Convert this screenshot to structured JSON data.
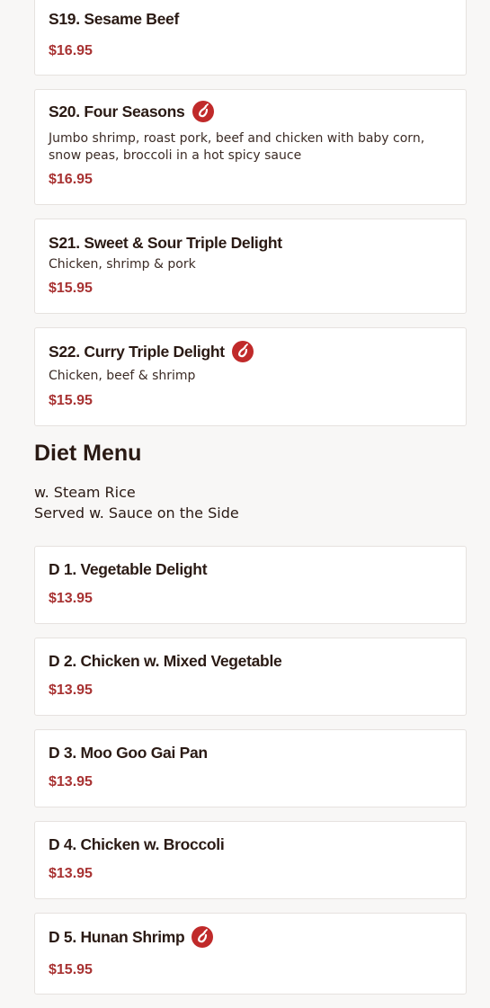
{
  "items_top": [
    {
      "name": "S19. Sesame Beef",
      "price": "$16.95",
      "spicy": false,
      "desc": ""
    },
    {
      "name": "S20. Four Seasons",
      "price": "$16.95",
      "spicy": true,
      "desc": "Jumbo shrimp, roast pork, beef and chicken with baby corn, snow peas, broccoli in a hot spicy sauce"
    },
    {
      "name": "S21. Sweet & Sour Triple Delight",
      "price": "$15.95",
      "spicy": false,
      "desc": "Chicken, shrimp & pork"
    },
    {
      "name": "S22. Curry Triple Delight",
      "price": "$15.95",
      "spicy": true,
      "desc": "Chicken, beef & shrimp"
    }
  ],
  "diet_section": {
    "title": "Diet Menu",
    "note_line1": "w. Steam Rice",
    "note_line2": "Served w. Sauce on the Side"
  },
  "items_diet": [
    {
      "name": "D 1. Vegetable Delight",
      "price": "$13.95",
      "spicy": false
    },
    {
      "name": "D 2. Chicken w. Mixed Vegetable",
      "price": "$13.95",
      "spicy": false
    },
    {
      "name": "D 3. Moo Goo Gai Pan",
      "price": "$13.95",
      "spicy": false
    },
    {
      "name": "D 4. Chicken w. Broccoli",
      "price": "$13.95",
      "spicy": false
    },
    {
      "name": "D 5. Hunan Shrimp",
      "price": "$15.95",
      "spicy": true
    }
  ],
  "icons": {
    "spicy": "chili-pepper-icon"
  },
  "colors": {
    "price": "#a83232",
    "spicy_badge": "#c02a2a",
    "background": "#f8f7f6"
  }
}
